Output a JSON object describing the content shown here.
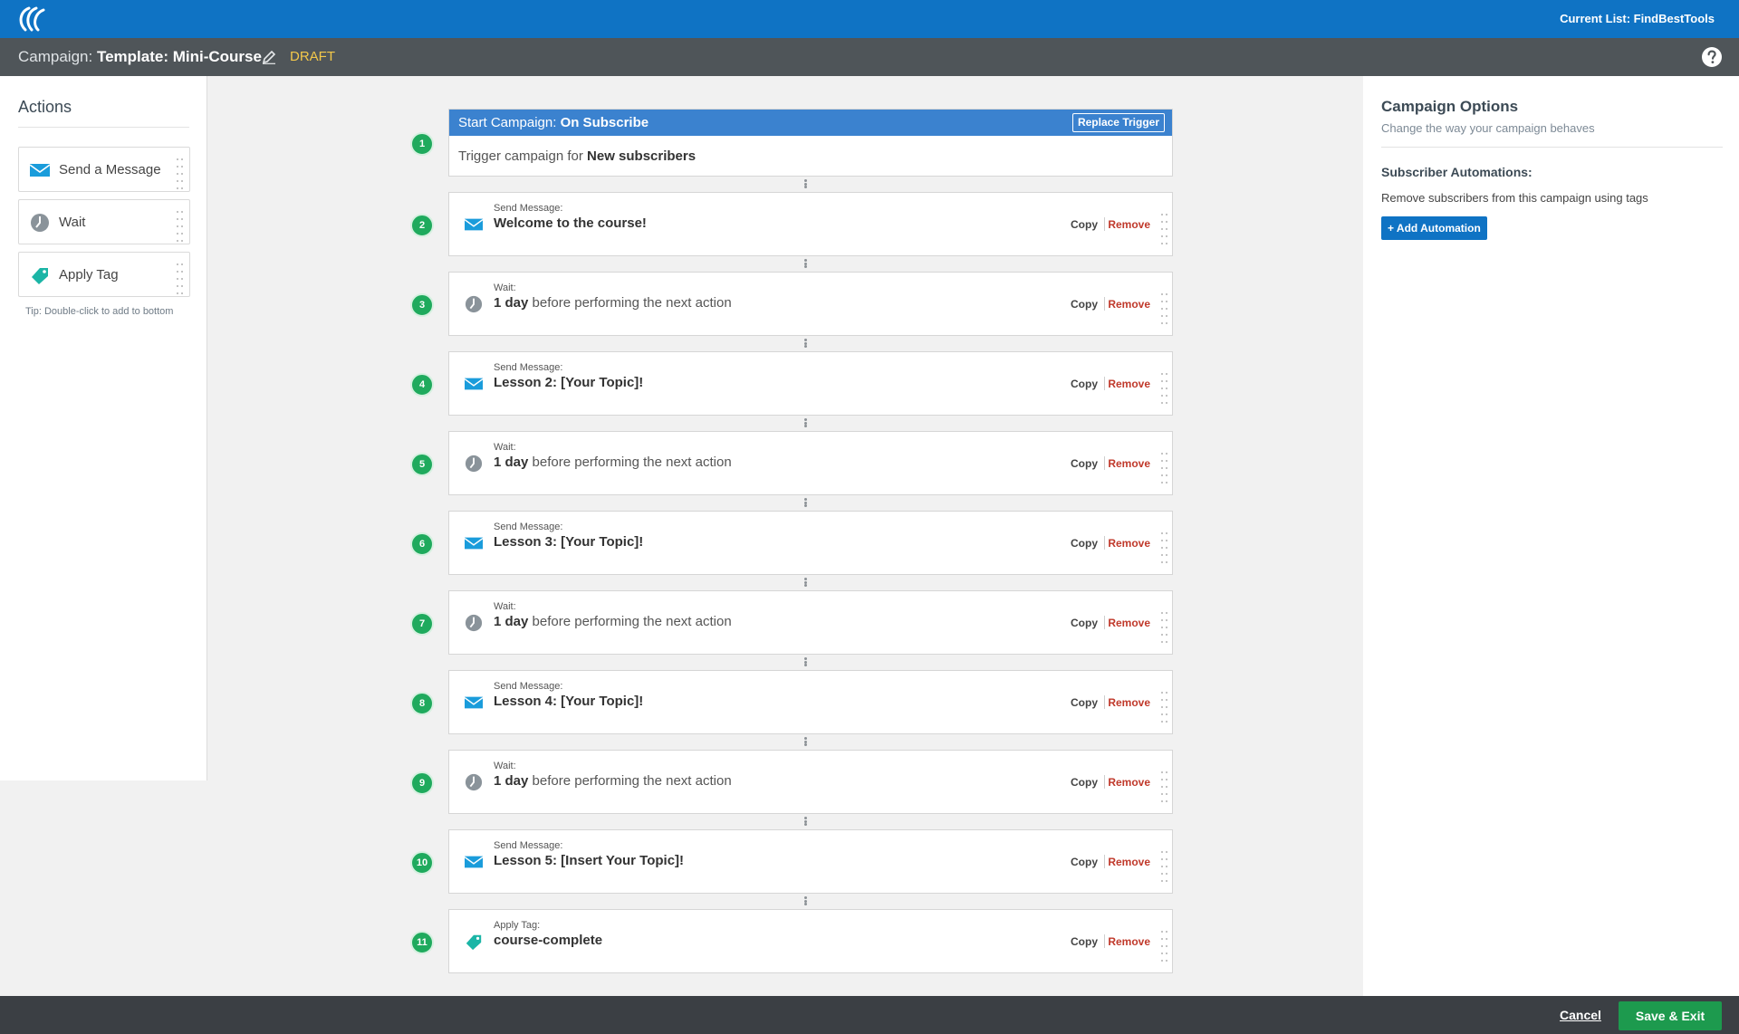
{
  "header": {
    "current_list": "Current List: FindBestTools",
    "campaign_prefix": "Campaign:",
    "campaign_name": "Template: Mini-Course",
    "status": "DRAFT"
  },
  "actions_panel": {
    "title": "Actions",
    "items": [
      {
        "label": "Send a Message",
        "icon": "envelope-icon"
      },
      {
        "label": "Wait",
        "icon": "clock-icon"
      },
      {
        "label": "Apply Tag",
        "icon": "tag-icon"
      }
    ],
    "tip": "Tip: Double-click to add to bottom"
  },
  "trigger": {
    "number": "1",
    "title_prefix": "Start Campaign:",
    "title_value": "On Subscribe",
    "replace_label": "Replace Trigger",
    "body_prefix": "Trigger campaign for",
    "body_value": "New subscribers"
  },
  "steps": [
    {
      "number": "2",
      "type": "Send Message:",
      "bold": "Welcome to the course!",
      "rest": "",
      "icon": "envelope-icon"
    },
    {
      "number": "3",
      "type": "Wait:",
      "bold": "1 day",
      "rest": " before performing the next action",
      "icon": "clock-icon"
    },
    {
      "number": "4",
      "type": "Send Message:",
      "bold": "Lesson 2: [Your Topic]!",
      "rest": "",
      "icon": "envelope-icon"
    },
    {
      "number": "5",
      "type": "Wait:",
      "bold": "1 day",
      "rest": " before performing the next action",
      "icon": "clock-icon"
    },
    {
      "number": "6",
      "type": "Send Message:",
      "bold": "Lesson 3: [Your Topic]!",
      "rest": "",
      "icon": "envelope-icon"
    },
    {
      "number": "7",
      "type": "Wait:",
      "bold": "1 day",
      "rest": " before performing the next action",
      "icon": "clock-icon"
    },
    {
      "number": "8",
      "type": "Send Message:",
      "bold": "Lesson 4: [Your Topic]!",
      "rest": "",
      "icon": "envelope-icon"
    },
    {
      "number": "9",
      "type": "Wait:",
      "bold": "1 day",
      "rest": " before performing the next action",
      "icon": "clock-icon"
    },
    {
      "number": "10",
      "type": "Send Message:",
      "bold": "Lesson 5: [Insert Your Topic]!",
      "rest": "",
      "icon": "envelope-icon"
    },
    {
      "number": "11",
      "type": "Apply Tag:",
      "bold": "course-complete",
      "rest": "",
      "icon": "tag-icon"
    }
  ],
  "step_actions": {
    "copy": "Copy",
    "remove": "Remove"
  },
  "options_panel": {
    "title": "Campaign Options",
    "subtitle": "Change the way your campaign behaves",
    "automations_title": "Subscriber Automations:",
    "automations_desc": "Remove subscribers from this campaign using tags",
    "add_label": "Add Automation",
    "add_prefix": "+"
  },
  "footer": {
    "cancel": "Cancel",
    "save": "Save & Exit"
  },
  "colors": {
    "topbar": "#0f73c4",
    "campbar": "#4f5559",
    "step_circle": "#1faa5d",
    "remove": "#c0392b",
    "save": "#1d9a4e",
    "draft": "#f3c84a"
  }
}
